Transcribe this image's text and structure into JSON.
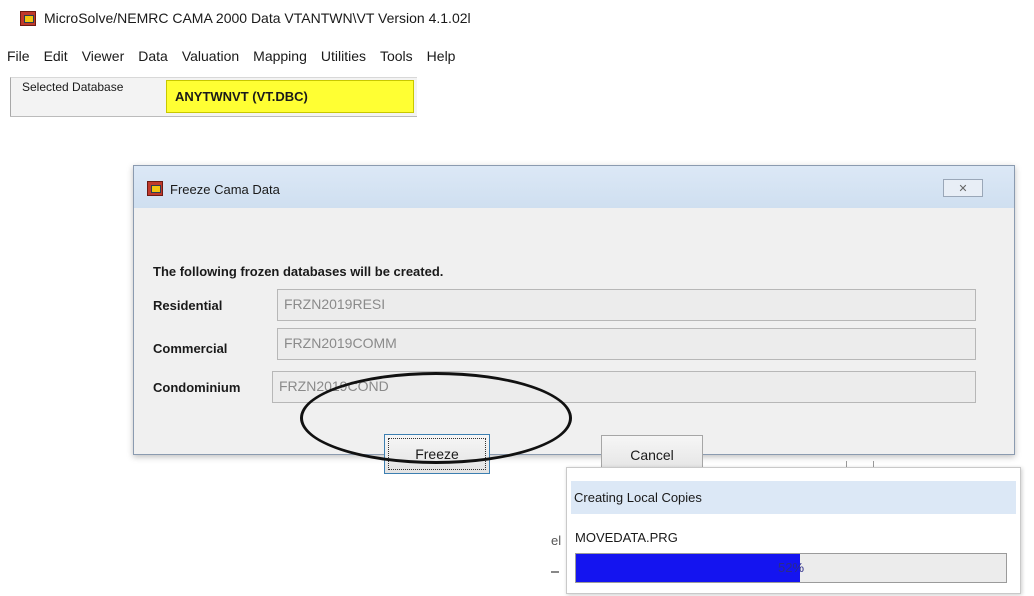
{
  "app": {
    "title": "MicroSolve/NEMRC CAMA 2000    Data VTANTWN\\VT Version 4.1.02l",
    "icon": "app-logo-icon"
  },
  "menu": [
    "File",
    "Edit",
    "Viewer",
    "Data",
    "Valuation",
    "Mapping",
    "Utilities",
    "Tools",
    "Help"
  ],
  "database_bar": {
    "label": "Selected Database",
    "value": "ANYTWNVT  (VT.DBC)",
    "highlight_color": "#ffff33"
  },
  "dialog": {
    "title": "Freeze Cama Data",
    "close_glyph": "✕",
    "intro": "The following frozen databases will be created.",
    "rows": [
      {
        "label": "Residential",
        "value": "FRZN2019RESI"
      },
      {
        "label": "Commercial",
        "value": "FRZN2019COMM"
      },
      {
        "label": "Condominium",
        "value": "FRZN2019COND"
      }
    ],
    "freeze_label": "Freeze",
    "cancel_label": "Cancel"
  },
  "progress": {
    "title": "Creating Local Copies",
    "file": "MOVEDATA.PRG",
    "percent": 52,
    "percent_text": "52%",
    "fill_color": "#1414f0"
  },
  "background_fragments": {
    "partial_text": "el"
  }
}
